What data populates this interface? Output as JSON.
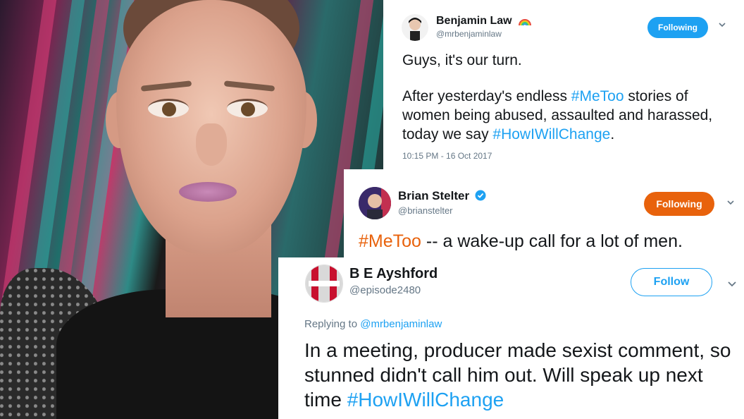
{
  "colors": {
    "link": "#1da1f2",
    "following_blue": "#1da1f2",
    "following_orange": "#e8620c",
    "follow_border": "#1da1f2",
    "text": "#14171a",
    "muted": "#657786"
  },
  "tweet1": {
    "name": "Benjamin Law",
    "badge_icon": "rainbow-icon",
    "handle": "@mrbenjaminlaw",
    "button": "Following",
    "chevron_icon": "chevron-down-icon",
    "line1": "Guys, it's our turn.",
    "p2_a": "After yesterday's endless ",
    "p2_tag1": "#MeToo",
    "p2_b": " stories of women being abused, assaulted and harassed, today we say ",
    "p2_tag2": "#HowIWillChange",
    "p2_c": ".",
    "timestamp": "10:15 PM - 16 Oct 2017"
  },
  "tweet2": {
    "name": "Brian Stelter",
    "badge_icon": "verified-icon",
    "handle": "@brianstelter",
    "button": "Following",
    "chevron_icon": "chevron-down-icon",
    "tag": "#MeToo",
    "text": " -- a wake-up call for a lot of men."
  },
  "tweet3": {
    "name": "B E Ayshford",
    "handle": "@episode2480",
    "button": "Follow",
    "chevron_icon": "chevron-down-icon",
    "replying_label": "Replying to ",
    "replying_handle": "@mrbenjaminlaw",
    "text": "In a meeting, producer made sexist comment, so stunned didn't call him out. Will speak up next time ",
    "tag": "#HowIWillChange"
  }
}
